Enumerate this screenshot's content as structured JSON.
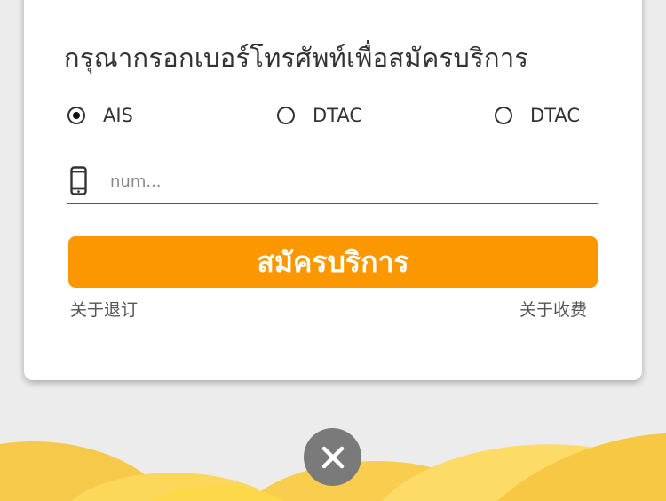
{
  "form": {
    "title": "กรุณากรอกเบอร์โทรศัพท์เพื่อสมัครบริการ",
    "operators": [
      {
        "label": "AIS",
        "selected": true
      },
      {
        "label": "DTAC",
        "selected": false
      },
      {
        "label": "DTAC",
        "selected": false
      }
    ],
    "phone_placeholder": "num...",
    "phone_value": "",
    "submit_label": "สมัครบริการ"
  },
  "links": {
    "unsubscribe": "关于退订",
    "billing": "关于收费"
  },
  "icons": {
    "phone": "phone-icon",
    "close": "close-icon"
  },
  "colors": {
    "accent": "#fb9700",
    "close_bg": "#7a7a7a",
    "wave_light": "#f9d25b",
    "wave_dark": "#f7c94a"
  }
}
